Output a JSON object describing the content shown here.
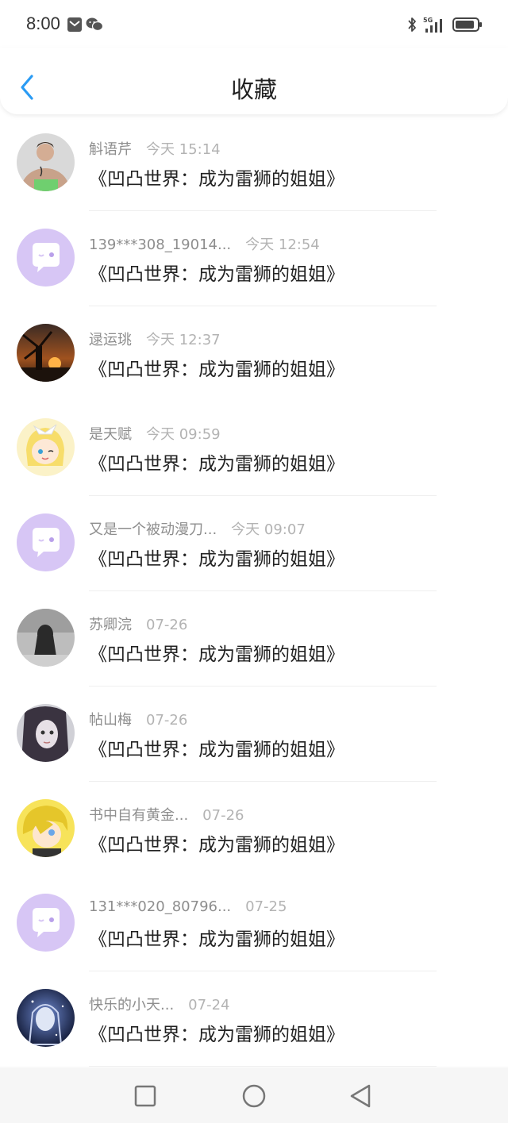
{
  "status_bar": {
    "time": "8:00",
    "left_icons": [
      "message-icon",
      "wechat-icon"
    ],
    "right_icons": [
      "bluetooth-icon",
      "signal-5g-icon",
      "battery-icon"
    ],
    "network_label": "5G"
  },
  "header": {
    "title": "收藏",
    "back_icon": "chevron-left-icon",
    "accent_color": "#2a9bf4"
  },
  "favorites": [
    {
      "name": "斛语芹",
      "time": "今天 15:14",
      "title": "《凹凸世界：成为雷狮的姐姐》",
      "avatar": "photo-man"
    },
    {
      "name": "139***308_19014...",
      "time": "今天 12:54",
      "title": "《凹凸世界：成为雷狮的姐姐》",
      "avatar": "default-chat-bubble"
    },
    {
      "name": "逯运珧",
      "time": "今天 12:37",
      "title": "《凹凸世界：成为雷狮的姐姐》",
      "avatar": "photo-sunset-windmill"
    },
    {
      "name": "是天赋",
      "time": "今天 09:59",
      "title": "《凹凸世界：成为雷狮的姐姐》",
      "avatar": "anime-blonde-girl"
    },
    {
      "name": "又是一个被动漫刀...",
      "time": "今天 09:07",
      "title": "《凹凸世界：成为雷狮的姐姐》",
      "avatar": "default-chat-bubble"
    },
    {
      "name": "苏卿浣",
      "time": "07-26",
      "title": "《凹凸世界：成为雷狮的姐姐》",
      "avatar": "photo-girl-gray"
    },
    {
      "name": "帖山梅",
      "time": "07-26",
      "title": "《凹凸世界：成为雷狮的姐姐》",
      "avatar": "photo-girl-dark"
    },
    {
      "name": "书中自有黄金...",
      "time": "07-26",
      "title": "《凹凸世界：成为雷狮的姐姐》",
      "avatar": "anime-yellow-hair"
    },
    {
      "name": "131***020_80796...",
      "time": "07-25",
      "title": "《凹凸世界：成为雷狮的姐姐》",
      "avatar": "default-chat-bubble"
    },
    {
      "name": "快乐的小天...",
      "time": "07-24",
      "title": "《凹凸世界：成为雷狮的姐姐》",
      "avatar": "anime-dark-blue"
    }
  ],
  "nav_bar": {
    "buttons": [
      "recent-apps-icon",
      "home-icon",
      "back-triangle-icon"
    ]
  }
}
